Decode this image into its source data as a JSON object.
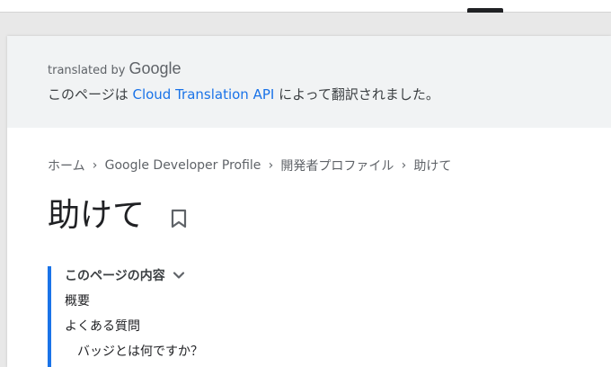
{
  "banner": {
    "translated_by": "translated by",
    "brand": "Google",
    "msg_before": "このページは ",
    "msg_link": "Cloud Translation API",
    "msg_after": " によって翻訳されました。"
  },
  "breadcrumb": {
    "items": [
      "ホーム",
      "Google Developer Profile",
      "開発者プロファイル",
      "助けて"
    ],
    "separator": "›"
  },
  "page": {
    "title": "助けて"
  },
  "toc": {
    "header": "このページの内容",
    "items": [
      "概要",
      "よくある質問",
      "バッジとは何ですか？"
    ]
  },
  "colors": {
    "accent": "#1a73e8",
    "banner_bg": "#f1f3f4",
    "text_secondary": "#5f6368"
  },
  "icons": {
    "bookmark": "bookmark-icon",
    "toc_toggle": "chevron-down-icon"
  }
}
